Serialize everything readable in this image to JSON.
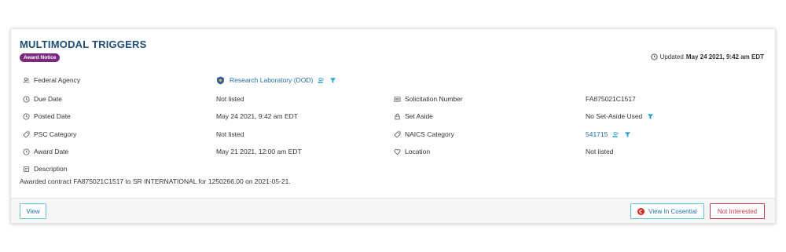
{
  "header": {
    "title": "MULTIMODAL TRIGGERS",
    "badge": "Award Notice",
    "updated_prefix": "Updated",
    "updated_value": "May 24 2021, 9:42 am EDT"
  },
  "fields": {
    "federal_agency": {
      "label": "Federal Agency",
      "value": "Research Laboratory (DOD)"
    },
    "due_date": {
      "label": "Due Date",
      "value": "Not listed"
    },
    "posted_date": {
      "label": "Posted Date",
      "value": "May 24 2021, 9:42 am EDT"
    },
    "psc_category": {
      "label": "PSC Category",
      "value": "Not listed"
    },
    "award_date": {
      "label": "Award Date",
      "value": "May 21 2021, 12:00 am EDT"
    },
    "solicitation_number": {
      "label": "Solicitation Number",
      "value": "FA875021C1517"
    },
    "set_aside": {
      "label": "Set Aside",
      "value": "No Set-Aside Used"
    },
    "naics_category": {
      "label": "NAICS Category",
      "value": "541715"
    },
    "location": {
      "label": "Location",
      "value": "Not listed"
    },
    "description": {
      "label": "Description",
      "value": "Awarded contract FA875021C1517 to  SR INTERNATIONAL for 1250266.00 on 2021-05-21."
    }
  },
  "footer": {
    "view_label": "View",
    "view_in_app_label": "View In Cosential",
    "not_interested_label": "Not Interested"
  },
  "colors": {
    "title": "#1f4e79",
    "badge": "#7b2a7f",
    "link": "#1f6fa8",
    "accent": "#2ba3c9",
    "danger": "#c23b4c"
  }
}
